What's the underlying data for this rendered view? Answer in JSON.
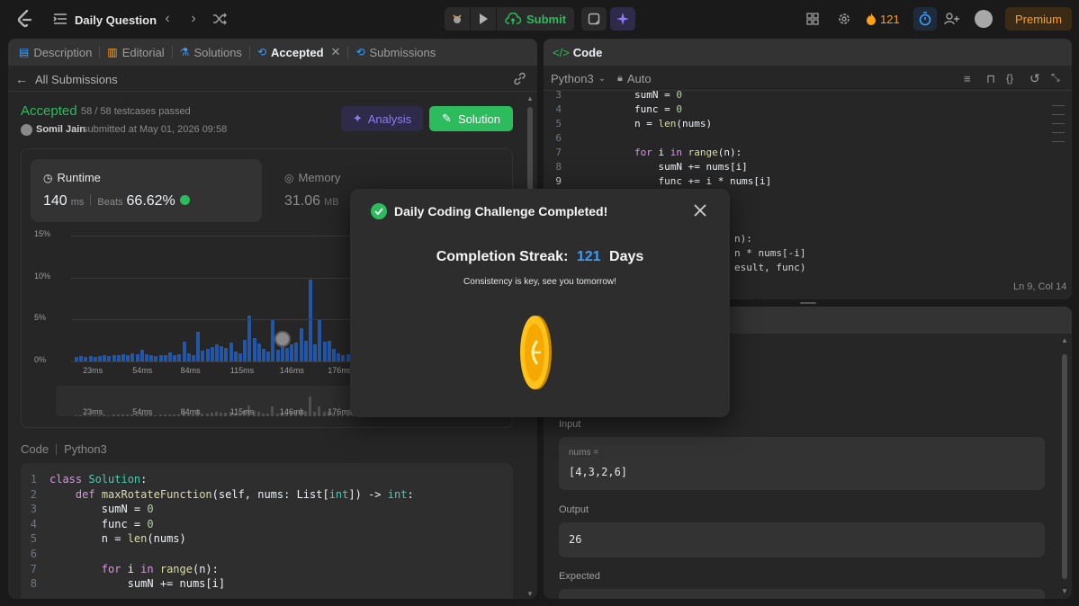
{
  "topbar": {
    "title": "Daily Question",
    "submit_label": "Submit",
    "streak_count": "121",
    "premium_label": "Premium"
  },
  "left_panel": {
    "tabs": [
      {
        "label": "Description",
        "icon": "description-icon"
      },
      {
        "label": "Editorial",
        "icon": "book-icon"
      },
      {
        "label": "Solutions",
        "icon": "flask-icon"
      },
      {
        "label": "Accepted",
        "icon": "history-icon"
      },
      {
        "label": "Submissions",
        "icon": "history-icon"
      }
    ],
    "back_label": "All Submissions",
    "status": "Accepted",
    "testcases": "58 / 58 testcases passed",
    "user": "Somil Jain",
    "submitted_text": "submitted at May 01, 2026 09:58",
    "analysis_label": "Analysis",
    "solution_label": "Solution",
    "runtime": {
      "label": "Runtime",
      "value": "140",
      "unit": "ms",
      "beats_label": "Beats",
      "beats_value": "66.62%"
    },
    "memory": {
      "label": "Memory",
      "value": "31.06",
      "unit": "MB"
    },
    "code_label": "Code",
    "language": "Python3"
  },
  "chart_data": {
    "type": "bar",
    "y_ticks": [
      "15%",
      "10%",
      "5%",
      "0%"
    ],
    "x_ticks": [
      "23ms",
      "54ms",
      "84ms",
      "115ms",
      "146ms",
      "176ms"
    ],
    "ylim": [
      0,
      15
    ],
    "xlim": [
      10,
      200
    ],
    "values": [
      0.5,
      0.6,
      0.5,
      0.6,
      0.5,
      0.6,
      0.7,
      0.6,
      0.8,
      0.7,
      0.9,
      0.8,
      1.0,
      0.9,
      1.4,
      0.9,
      0.8,
      0.6,
      0.8,
      0.7,
      1.1,
      0.7,
      0.9,
      2.4,
      1.0,
      0.8,
      3.5,
      1.3,
      1.5,
      1.7,
      2.0,
      1.8,
      1.6,
      2.2,
      1.2,
      1.0,
      2.6,
      5.5,
      2.8,
      2.1,
      1.5,
      1.2,
      5.0,
      1.4,
      1.9,
      1.6,
      2.0,
      2.3,
      4.0,
      2.5,
      9.8,
      2.0,
      4.9,
      2.4,
      2.5,
      1.5,
      1.0,
      0.8,
      0.9,
      1.1,
      0.7,
      0.8,
      0.6,
      0.5,
      0.5
    ],
    "highlight_index": 44,
    "bar_color": "#2456a6"
  },
  "left_code": [
    {
      "n": "1",
      "t": "class Solution:"
    },
    {
      "n": "2",
      "t": "    def maxRotateFunction(self, nums: List[int]) -> int:"
    },
    {
      "n": "3",
      "t": "        sumN = 0"
    },
    {
      "n": "4",
      "t": "        func = 0"
    },
    {
      "n": "5",
      "t": "        n = len(nums)"
    },
    {
      "n": "6",
      "t": ""
    },
    {
      "n": "7",
      "t": "        for i in range(n):"
    },
    {
      "n": "8",
      "t": "            sumN += nums[i]"
    }
  ],
  "right_panel": {
    "code_tab": "Code",
    "language": "Python3",
    "auto_label": "Auto",
    "cursor_pos": "Ln 9, Col 14",
    "code": [
      {
        "n": "3",
        "t": "        sumN = 0"
      },
      {
        "n": "4",
        "t": "        func = 0"
      },
      {
        "n": "5",
        "t": "        n = len(nums)"
      },
      {
        "n": "6",
        "t": ""
      },
      {
        "n": "7",
        "t": "        for i in range(n):"
      },
      {
        "n": "8",
        "t": "            sumN += nums[i]"
      },
      {
        "n": "9",
        "t": "            func += i * nums[i]"
      }
    ],
    "partial_lines": [
      "n):",
      "n * nums[-i]",
      "esult, func)"
    ],
    "input_label": "Input",
    "input_var": "nums =",
    "input_value": "[4,3,2,6]",
    "output_label": "Output",
    "output_value": "26",
    "expected_label": "Expected"
  },
  "modal": {
    "title": "Daily Coding Challenge Completed!",
    "streak_prefix": "Completion Streak:",
    "streak_value": "121",
    "streak_suffix": "Days",
    "subtitle": "Consistency is key, see you tomorrow!"
  },
  "colors": {
    "accepted": "#2cbb5d",
    "streak": "#3b9eff",
    "fire": "#ffa116",
    "premium": "#ffa116"
  }
}
